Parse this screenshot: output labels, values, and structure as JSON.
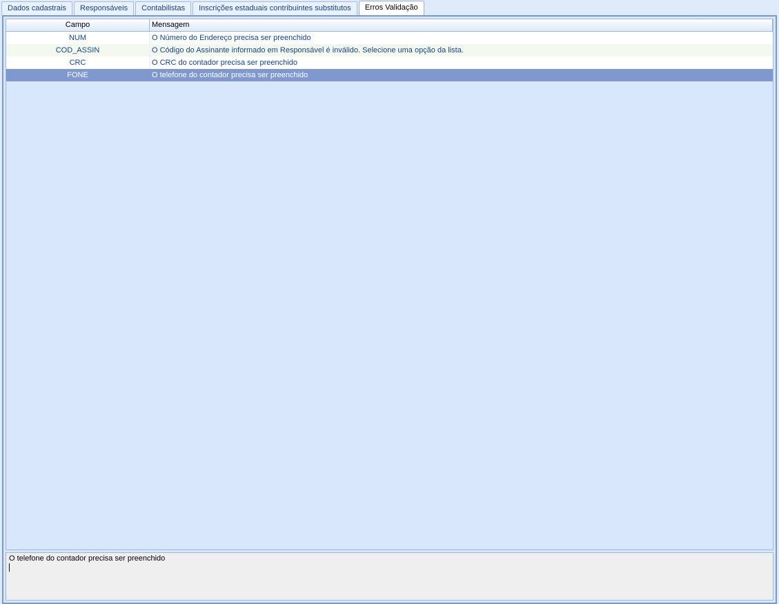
{
  "tabs": [
    {
      "label": "Dados cadastrais",
      "active": false
    },
    {
      "label": "Responsáveis",
      "active": false
    },
    {
      "label": "Contabilistas",
      "active": false
    },
    {
      "label": "Inscrições estaduais contribuintes substitutos",
      "active": false
    },
    {
      "label": "Erros Validação",
      "active": true
    }
  ],
  "columns": {
    "campo": "Campo",
    "mensagem": "Mensagem"
  },
  "rows": [
    {
      "campo": "NUM",
      "mensagem": "O Número do Endereço precisa ser preenchido",
      "selected": false
    },
    {
      "campo": "COD_ASSIN",
      "mensagem": "O Código do Assinante informado em Responsável é inválido. Selecione uma opção da lista.",
      "selected": false
    },
    {
      "campo": "CRC",
      "mensagem": "O CRC do contador precisa ser preenchido",
      "selected": false
    },
    {
      "campo": "FONE",
      "mensagem": "O telefone do contador precisa ser preenchido",
      "selected": true
    }
  ],
  "detail": "O telefone do contador precisa ser preenchido"
}
